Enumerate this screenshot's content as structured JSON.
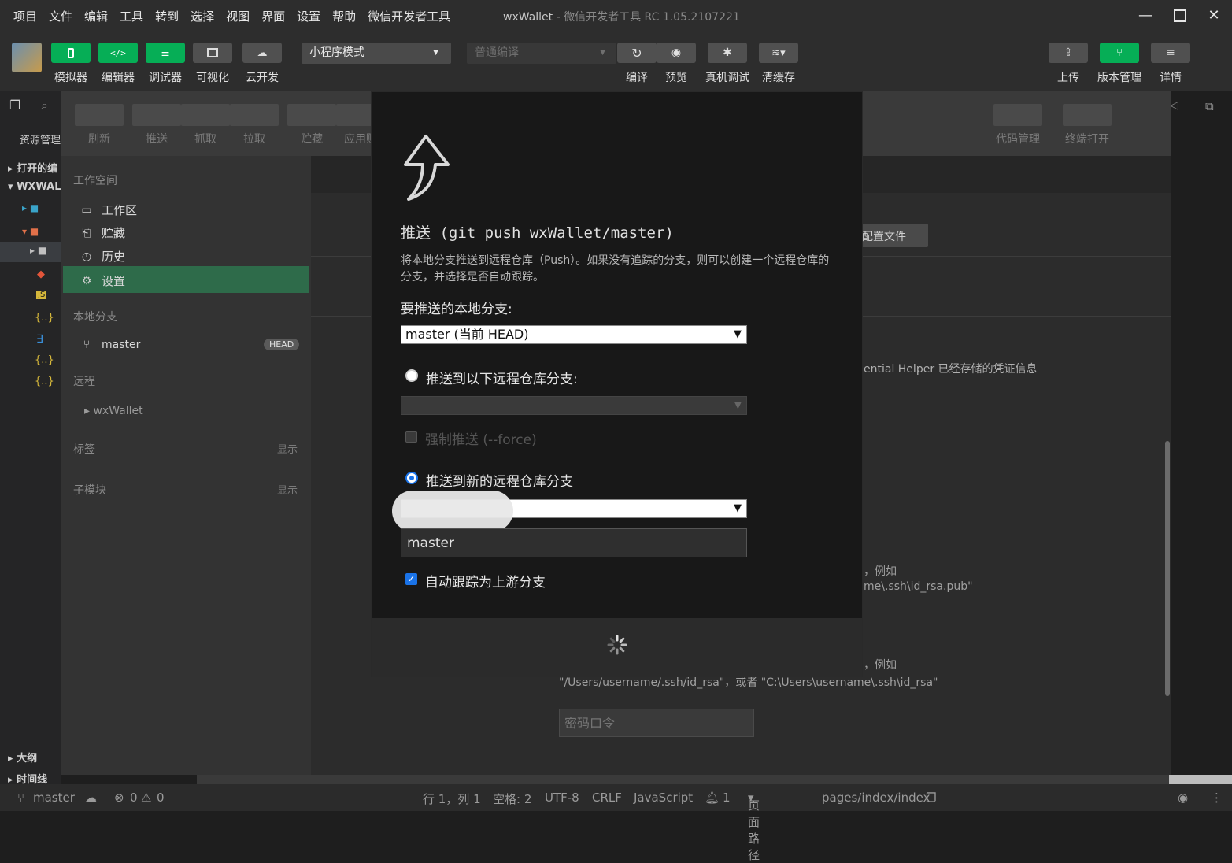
{
  "menu": [
    "项目",
    "文件",
    "编辑",
    "工具",
    "转到",
    "选择",
    "视图",
    "界面",
    "设置",
    "帮助",
    "微信开发者工具"
  ],
  "window": {
    "app": "wxWallet",
    "title": "微信开发者工具 RC 1.05.2107221"
  },
  "toolbar": {
    "left": [
      "模拟器",
      "编辑器",
      "调试器",
      "可视化",
      "云开发"
    ],
    "mode_select": "小程序模式",
    "compile_select": "普通编译",
    "middle": [
      "编译",
      "预览",
      "真机调试",
      "清缓存"
    ],
    "right": [
      "上传",
      "版本管理",
      "详情"
    ]
  },
  "explorer": {
    "title": "资源管理",
    "open_editors": "打开的编",
    "project": "WXWAL",
    "outline": "大纲",
    "timeline": "时间线"
  },
  "vcs_toolbar": {
    "buttons": [
      "刷新",
      "推送",
      "抓取",
      "拉取",
      "贮藏",
      "应用贮"
    ],
    "right_buttons": [
      "代码管理",
      "终端打开"
    ]
  },
  "vcs_sidebar": {
    "workspace": "工作空间",
    "items": [
      "工作区",
      "贮藏",
      "历史",
      "设置"
    ],
    "local_branches": "本地分支",
    "branch": "master",
    "head_badge": "HEAD",
    "remote": "远程",
    "remote_item": "wxWallet",
    "tags": "标签",
    "submodules": "子模块",
    "show": "显示"
  },
  "settings_bg": {
    "config_btn": "配置文件",
    "credential_text": "ential Helper 已经存储的凭证信息",
    "example1": "，例如",
    "pubkey_path": "me\\.ssh\\id_rsa.pub\"",
    "example2": "，例如",
    "rsa_paths": "\"/Users/username/.ssh/id_rsa\"，或者 \"C:\\Users\\username\\.ssh\\id_rsa\"",
    "passphrase_placeholder": "密码口令"
  },
  "modal": {
    "title": "推送 (git push wxWallet/master)",
    "description": "将本地分支推送到远程仓库（Push）。如果没有追踪的分支，则可以创建一个远程仓库的分支，并选择是否自动跟踪。",
    "local_branch_label": "要推送的本地分支:",
    "local_branch_value": "master (当前 HEAD)",
    "option_existing": "推送到以下远程仓库分支:",
    "force_label": "强制推送 (--force)",
    "option_new": "推送到新的远程仓库分支",
    "new_branch_value": "master",
    "auto_track": "自动跟踪为上游分支",
    "selected_option": "new",
    "auto_track_checked": true
  },
  "status": {
    "branch": "master",
    "errors": "0",
    "warnings": "0",
    "position": "行 1，列 1",
    "spaces": "空格: 2",
    "encoding": "UTF-8",
    "eol": "CRLF",
    "language": "JavaScript",
    "notifications": "1",
    "page_path_label": "页面路径",
    "page_path": "pages/index/index"
  },
  "colors": {
    "accent_green": "#06ae56",
    "selected_row": "#2e6b4a",
    "radio_blue": "#1a73e8"
  }
}
